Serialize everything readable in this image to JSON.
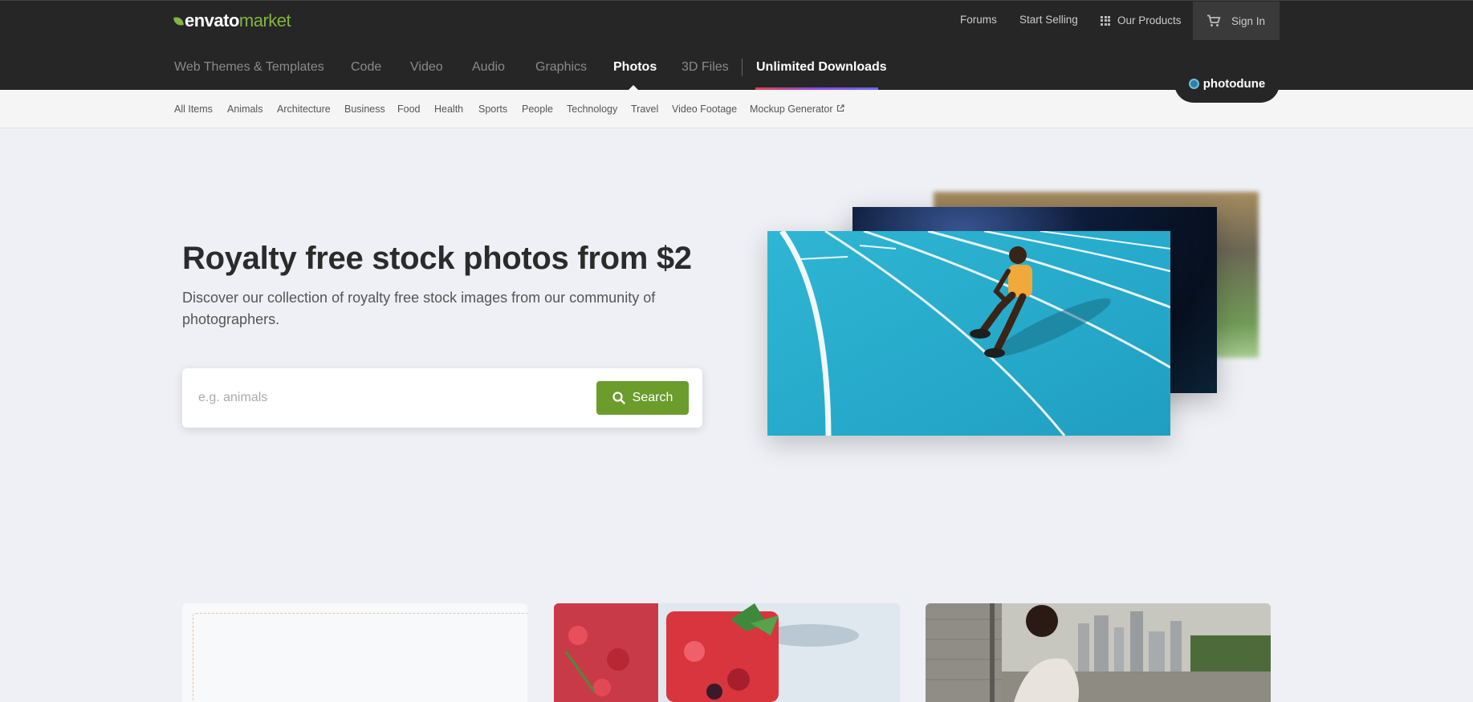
{
  "brand": {
    "logo_word1": "envato",
    "logo_word2": "market",
    "accent_color": "#82b541",
    "badge": "photodune"
  },
  "top_links": {
    "forums": "Forums",
    "start_selling": "Start Selling",
    "our_products": "Our Products",
    "sign_in": "Sign In"
  },
  "main_nav": [
    {
      "label": "Web Themes & Templates",
      "active": false
    },
    {
      "label": "Code",
      "active": false
    },
    {
      "label": "Video",
      "active": false
    },
    {
      "label": "Audio",
      "active": false
    },
    {
      "label": "Graphics",
      "active": false
    },
    {
      "label": "Photos",
      "active": true
    },
    {
      "label": "3D Files",
      "active": false
    },
    {
      "label": "Unlimited Downloads",
      "active": false
    }
  ],
  "sub_nav": [
    "All Items",
    "Animals",
    "Architecture",
    "Business",
    "Food",
    "Health",
    "Sports",
    "People",
    "Technology",
    "Travel",
    "Video Footage",
    "Mockup Generator"
  ],
  "hero": {
    "title": "Royalty free stock photos from $2",
    "subtitle": "Discover our collection of royalty free stock images from our community of photographers."
  },
  "search": {
    "placeholder": "e.g. animals",
    "value": "",
    "button_label": "Search",
    "button_color": "#6b9c2c"
  }
}
